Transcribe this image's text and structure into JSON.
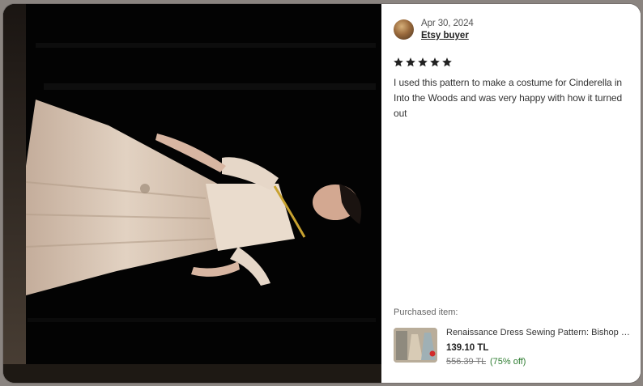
{
  "review": {
    "date": "Apr 30, 2024",
    "reviewer": "Etsy buyer",
    "rating": 5,
    "rating_max": 5,
    "text": "I used this pattern to make a costume for Cinderella in Into the Woods and was very happy with how it turned out",
    "purchased_label": "Purchased item:",
    "product": {
      "title": "Renaissance Dress Sewing Pattern: Bishop Sl...",
      "price": "139.10 TL",
      "original_price": "556.39 TL",
      "discount": "(75% off)"
    }
  },
  "colors": {
    "star": "#222222",
    "discount": "#2f7d32",
    "photo_background": "#040404"
  },
  "icons": {
    "star": "star-icon"
  }
}
